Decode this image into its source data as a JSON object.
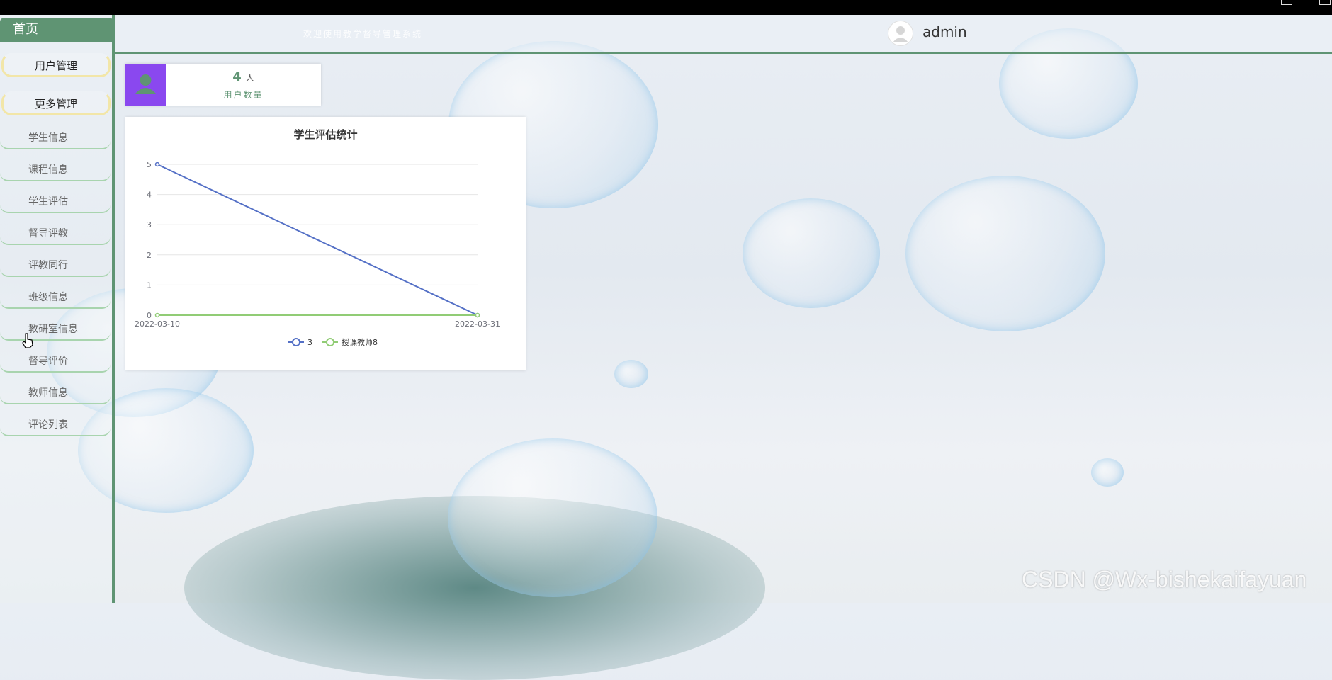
{
  "header": {
    "welcome_text": "欢迎使用教学督导管理系统",
    "username": "admin"
  },
  "sidebar": {
    "home_label": "首页",
    "menus": [
      {
        "label": "用户管理"
      },
      {
        "label": "更多管理"
      }
    ],
    "items": [
      {
        "label": "学生信息"
      },
      {
        "label": "课程信息"
      },
      {
        "label": "学生评估"
      },
      {
        "label": "督导评教"
      },
      {
        "label": "评教同行"
      },
      {
        "label": "班级信息"
      },
      {
        "label": "教研室信息"
      },
      {
        "label": "督导评价"
      },
      {
        "label": "教师信息"
      },
      {
        "label": "评论列表"
      }
    ]
  },
  "stat": {
    "value": "4",
    "unit": "人",
    "label": "用户数量"
  },
  "chart_data": {
    "type": "line",
    "title": "学生评估统计",
    "categories": [
      "2022-03-10",
      "2022-03-31"
    ],
    "ylim": [
      0,
      5
    ],
    "yticks": [
      0,
      1,
      2,
      3,
      4,
      5
    ],
    "series": [
      {
        "name": "3",
        "values": [
          5,
          0
        ],
        "color": "#5470c6"
      },
      {
        "name": "授课教师8",
        "values": [
          0,
          0
        ],
        "color": "#91cc75"
      }
    ],
    "grid": true,
    "legend": "bottom"
  },
  "watermark": "CSDN @Wx-bishekaifayuan"
}
